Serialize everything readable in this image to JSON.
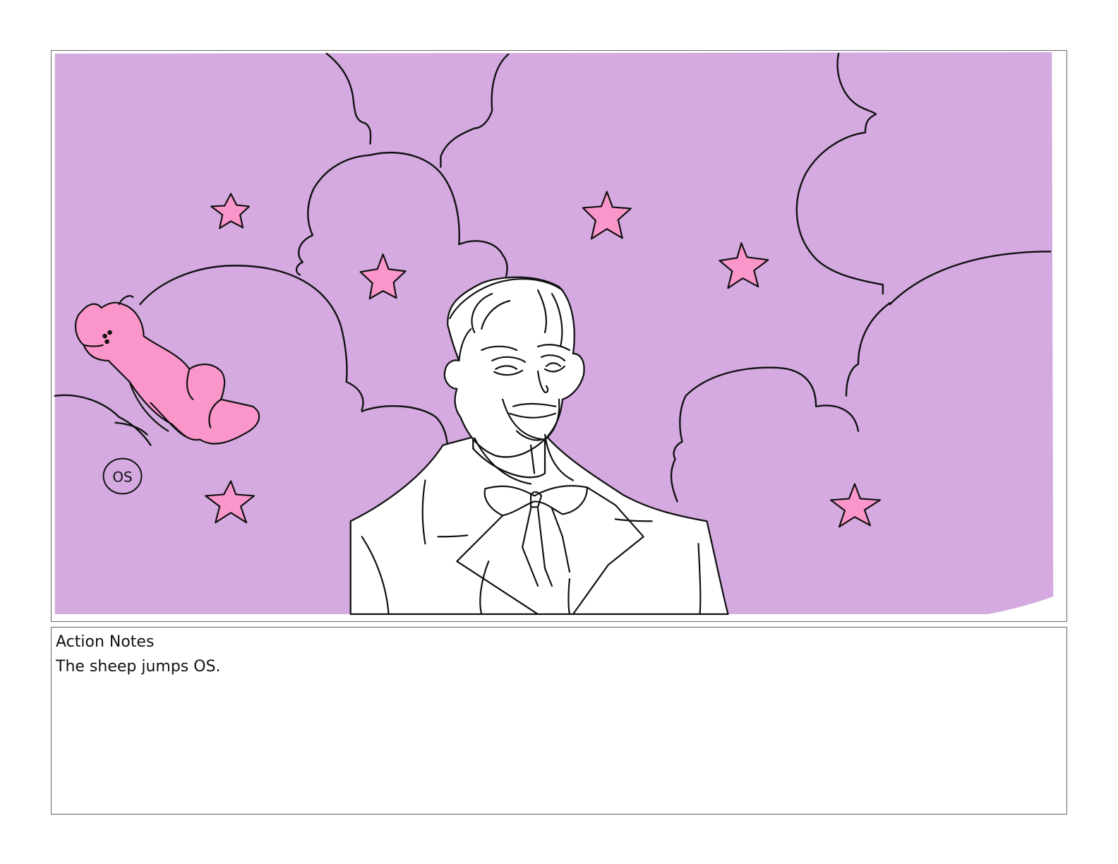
{
  "panel": {
    "background_color": "#d4aae0",
    "accent_color": "#fb96ca",
    "line_color": "#111111",
    "offscreen_mark": "OS"
  },
  "notes": {
    "title": "Action Notes",
    "text": "The sheep jumps OS."
  }
}
